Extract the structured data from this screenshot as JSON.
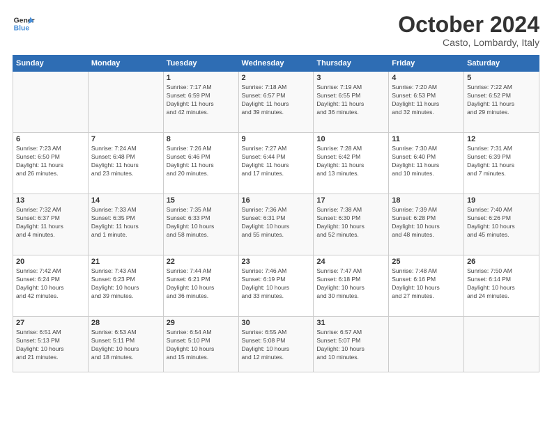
{
  "logo": {
    "line1": "General",
    "line2": "Blue"
  },
  "title": "October 2024",
  "subtitle": "Casto, Lombardy, Italy",
  "days_header": [
    "Sunday",
    "Monday",
    "Tuesday",
    "Wednesday",
    "Thursday",
    "Friday",
    "Saturday"
  ],
  "weeks": [
    [
      {
        "num": "",
        "detail": ""
      },
      {
        "num": "",
        "detail": ""
      },
      {
        "num": "1",
        "detail": "Sunrise: 7:17 AM\nSunset: 6:59 PM\nDaylight: 11 hours\nand 42 minutes."
      },
      {
        "num": "2",
        "detail": "Sunrise: 7:18 AM\nSunset: 6:57 PM\nDaylight: 11 hours\nand 39 minutes."
      },
      {
        "num": "3",
        "detail": "Sunrise: 7:19 AM\nSunset: 6:55 PM\nDaylight: 11 hours\nand 36 minutes."
      },
      {
        "num": "4",
        "detail": "Sunrise: 7:20 AM\nSunset: 6:53 PM\nDaylight: 11 hours\nand 32 minutes."
      },
      {
        "num": "5",
        "detail": "Sunrise: 7:22 AM\nSunset: 6:52 PM\nDaylight: 11 hours\nand 29 minutes."
      }
    ],
    [
      {
        "num": "6",
        "detail": "Sunrise: 7:23 AM\nSunset: 6:50 PM\nDaylight: 11 hours\nand 26 minutes."
      },
      {
        "num": "7",
        "detail": "Sunrise: 7:24 AM\nSunset: 6:48 PM\nDaylight: 11 hours\nand 23 minutes."
      },
      {
        "num": "8",
        "detail": "Sunrise: 7:26 AM\nSunset: 6:46 PM\nDaylight: 11 hours\nand 20 minutes."
      },
      {
        "num": "9",
        "detail": "Sunrise: 7:27 AM\nSunset: 6:44 PM\nDaylight: 11 hours\nand 17 minutes."
      },
      {
        "num": "10",
        "detail": "Sunrise: 7:28 AM\nSunset: 6:42 PM\nDaylight: 11 hours\nand 13 minutes."
      },
      {
        "num": "11",
        "detail": "Sunrise: 7:30 AM\nSunset: 6:40 PM\nDaylight: 11 hours\nand 10 minutes."
      },
      {
        "num": "12",
        "detail": "Sunrise: 7:31 AM\nSunset: 6:39 PM\nDaylight: 11 hours\nand 7 minutes."
      }
    ],
    [
      {
        "num": "13",
        "detail": "Sunrise: 7:32 AM\nSunset: 6:37 PM\nDaylight: 11 hours\nand 4 minutes."
      },
      {
        "num": "14",
        "detail": "Sunrise: 7:33 AM\nSunset: 6:35 PM\nDaylight: 11 hours\nand 1 minute."
      },
      {
        "num": "15",
        "detail": "Sunrise: 7:35 AM\nSunset: 6:33 PM\nDaylight: 10 hours\nand 58 minutes."
      },
      {
        "num": "16",
        "detail": "Sunrise: 7:36 AM\nSunset: 6:31 PM\nDaylight: 10 hours\nand 55 minutes."
      },
      {
        "num": "17",
        "detail": "Sunrise: 7:38 AM\nSunset: 6:30 PM\nDaylight: 10 hours\nand 52 minutes."
      },
      {
        "num": "18",
        "detail": "Sunrise: 7:39 AM\nSunset: 6:28 PM\nDaylight: 10 hours\nand 48 minutes."
      },
      {
        "num": "19",
        "detail": "Sunrise: 7:40 AM\nSunset: 6:26 PM\nDaylight: 10 hours\nand 45 minutes."
      }
    ],
    [
      {
        "num": "20",
        "detail": "Sunrise: 7:42 AM\nSunset: 6:24 PM\nDaylight: 10 hours\nand 42 minutes."
      },
      {
        "num": "21",
        "detail": "Sunrise: 7:43 AM\nSunset: 6:23 PM\nDaylight: 10 hours\nand 39 minutes."
      },
      {
        "num": "22",
        "detail": "Sunrise: 7:44 AM\nSunset: 6:21 PM\nDaylight: 10 hours\nand 36 minutes."
      },
      {
        "num": "23",
        "detail": "Sunrise: 7:46 AM\nSunset: 6:19 PM\nDaylight: 10 hours\nand 33 minutes."
      },
      {
        "num": "24",
        "detail": "Sunrise: 7:47 AM\nSunset: 6:18 PM\nDaylight: 10 hours\nand 30 minutes."
      },
      {
        "num": "25",
        "detail": "Sunrise: 7:48 AM\nSunset: 6:16 PM\nDaylight: 10 hours\nand 27 minutes."
      },
      {
        "num": "26",
        "detail": "Sunrise: 7:50 AM\nSunset: 6:14 PM\nDaylight: 10 hours\nand 24 minutes."
      }
    ],
    [
      {
        "num": "27",
        "detail": "Sunrise: 6:51 AM\nSunset: 5:13 PM\nDaylight: 10 hours\nand 21 minutes."
      },
      {
        "num": "28",
        "detail": "Sunrise: 6:53 AM\nSunset: 5:11 PM\nDaylight: 10 hours\nand 18 minutes."
      },
      {
        "num": "29",
        "detail": "Sunrise: 6:54 AM\nSunset: 5:10 PM\nDaylight: 10 hours\nand 15 minutes."
      },
      {
        "num": "30",
        "detail": "Sunrise: 6:55 AM\nSunset: 5:08 PM\nDaylight: 10 hours\nand 12 minutes."
      },
      {
        "num": "31",
        "detail": "Sunrise: 6:57 AM\nSunset: 5:07 PM\nDaylight: 10 hours\nand 10 minutes."
      },
      {
        "num": "",
        "detail": ""
      },
      {
        "num": "",
        "detail": ""
      }
    ]
  ]
}
